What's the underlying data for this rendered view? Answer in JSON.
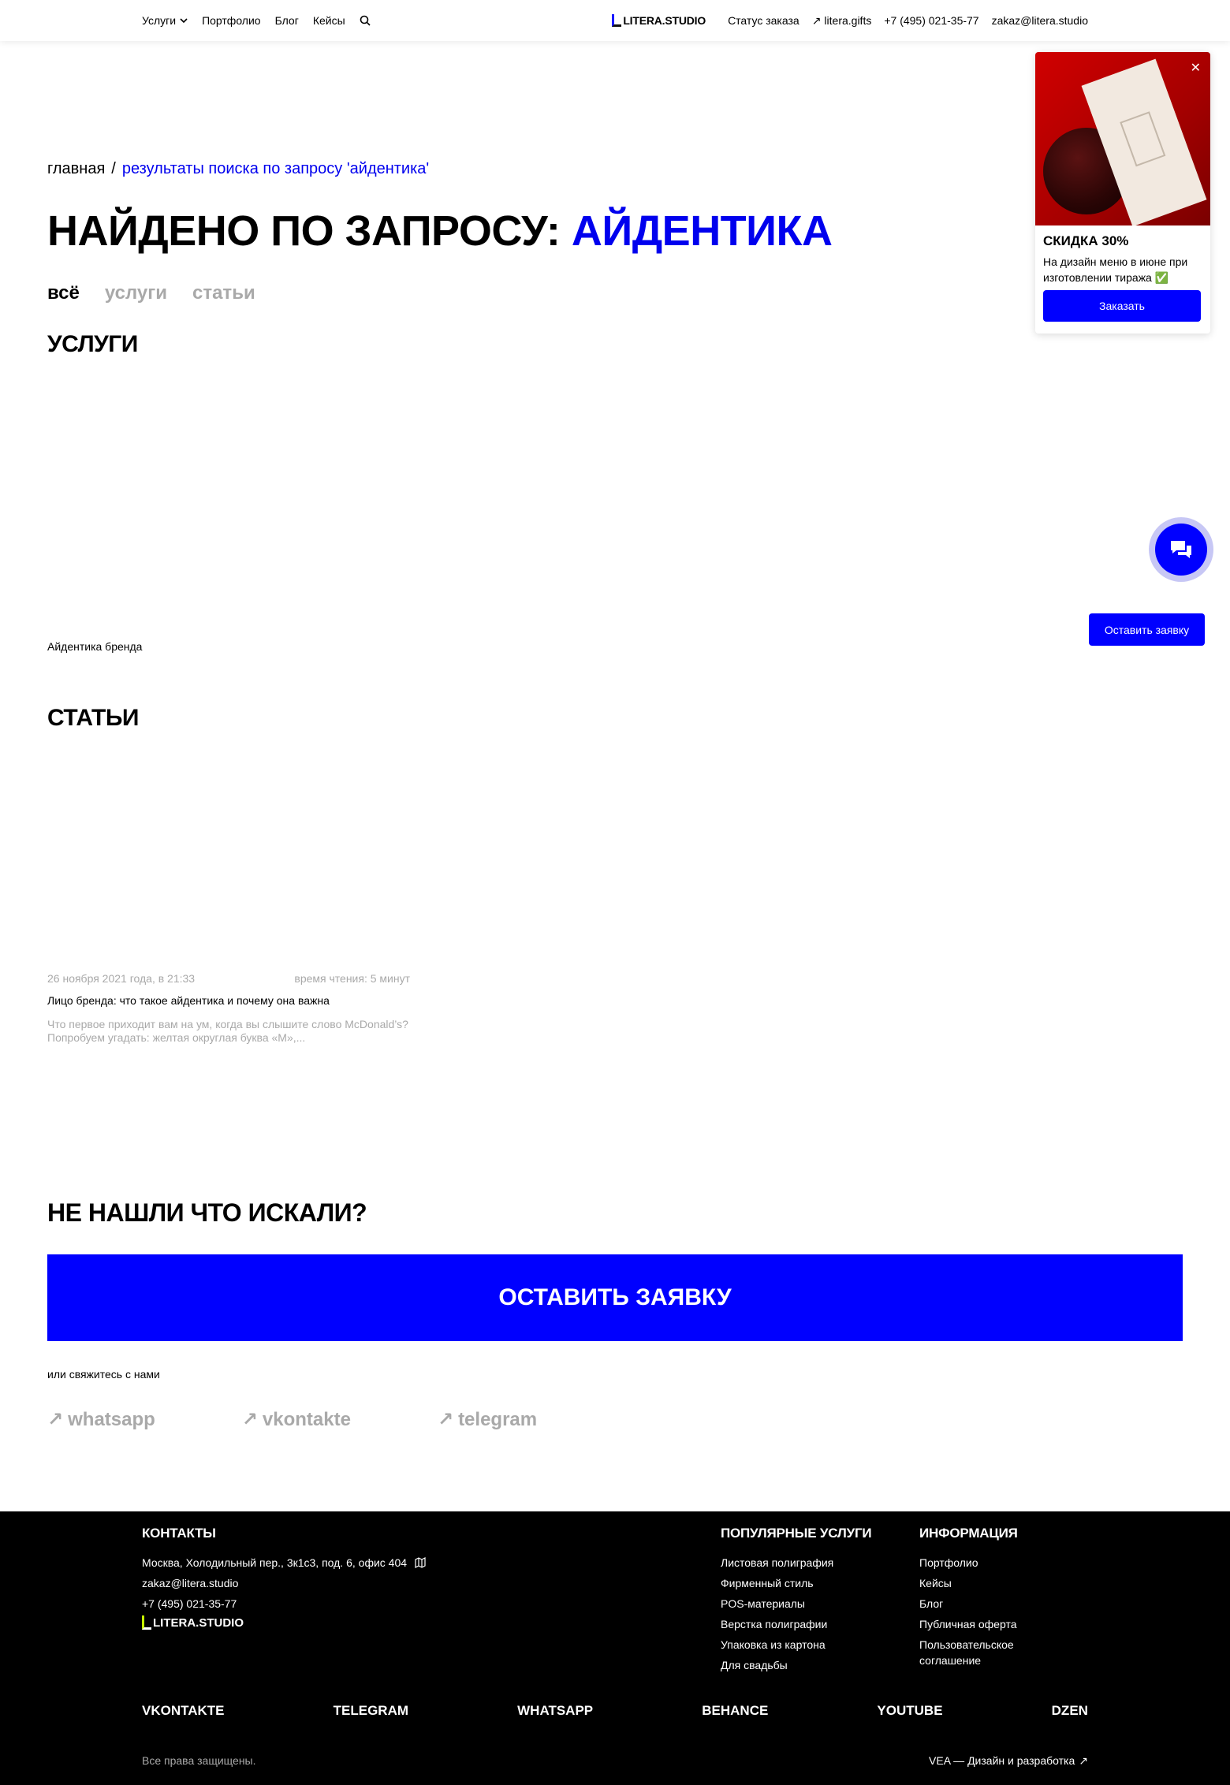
{
  "header": {
    "nav": [
      {
        "label": "Услуги",
        "has_dropdown": true
      },
      {
        "label": "Портфолио"
      },
      {
        "label": "Блог"
      },
      {
        "label": "Кейсы"
      }
    ],
    "logo_text": "LITERA.STUDIO",
    "order_status": "Статус заказа",
    "gifts_link": "litera.gifts",
    "phone": "+7 (495) 021-35-77",
    "email": "zakaz@litera.studio"
  },
  "breadcrumb": {
    "home": "главная",
    "separator": "/",
    "current": "результаты поиска по запросу 'айдентика'"
  },
  "title": {
    "prefix": "НАЙДЕНО ПО ЗАПРОСУ:",
    "query": "АЙДЕНТИКА"
  },
  "tabs": [
    {
      "label": "всё",
      "active": true
    },
    {
      "label": "услуги",
      "active": false
    },
    {
      "label": "статьи",
      "active": false
    }
  ],
  "services": {
    "heading": "УСЛУГИ",
    "items": [
      "Айдентика бренда"
    ]
  },
  "articles": {
    "heading": "СТАТЬИ",
    "items": [
      {
        "date": "26 ноября 2021 года, в 21:33",
        "read_time": "время чтения: 5 минут",
        "title": "Лицо бренда: что такое айдентика и почему она важна",
        "excerpt": "Что первое приходит вам на ум, когда вы слышите слово McDonald’s? Попробуем угадать: желтая округлая буква «М»,..."
      }
    ]
  },
  "cta": {
    "heading": "НЕ НАШЛИ ЧТО ИСКАЛИ?",
    "button": "ОСТАВИТЬ ЗАЯВКУ",
    "contact_note": "или свяжитесь с нами",
    "links": [
      "whatsapp",
      "vkontakte",
      "telegram"
    ]
  },
  "promo": {
    "title": "СКИДКА 30%",
    "text": "На дизайн меню в июне при изготовлении тиража ✅",
    "button": "Заказать"
  },
  "floating": {
    "request_button": "Оставить заявку"
  },
  "footer": {
    "contacts": {
      "heading": "КОНТАКТЫ",
      "address": "Москва, Холодильный пер., 3к1с3, под. 6, офис 404",
      "email": "zakaz@litera.studio",
      "phone": "+7 (495) 021-35-77",
      "logo_text": "LITERA.STUDIO"
    },
    "services": {
      "heading": "ПОПУЛЯРНЫЕ УСЛУГИ",
      "items": [
        "Листовая полиграфия",
        "Фирменный стиль",
        "POS-материалы",
        "Верстка полиграфии",
        "Упаковка из картона",
        "Для свадьбы"
      ]
    },
    "info": {
      "heading": "ИНФОРМАЦИЯ",
      "items": [
        "Портфолио",
        "Кейсы",
        "Блог",
        "Публичная оферта",
        "Пользовательское соглашение"
      ]
    },
    "socials": [
      "VKONTAKTE",
      "TELEGRAM",
      "WHATSAPP",
      "BEHANCE",
      "YOUTUBE",
      "DZEN"
    ],
    "rights": "Все права защищены.",
    "developer": "VEA — Дизайн и разработка"
  },
  "colors": {
    "accent": "#0000ff",
    "link": "#0000ee",
    "muted": "#a9a9a9",
    "footer_bg": "#000000",
    "logo_green": "#c6ff00"
  }
}
